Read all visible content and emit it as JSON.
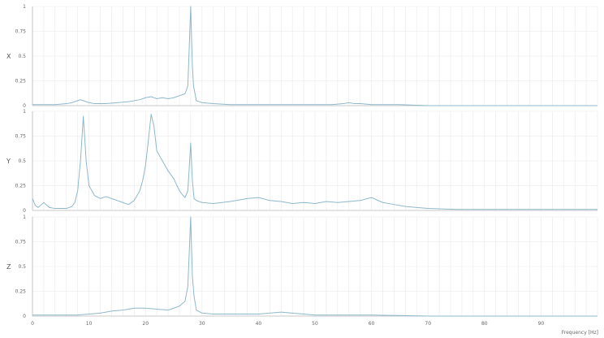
{
  "chart_data": {
    "type": "line",
    "xlabel": "Frequency [Hz]",
    "x_ticks": [
      0,
      10,
      20,
      30,
      40,
      50,
      60,
      70,
      80,
      90
    ],
    "xlim": [
      0,
      100
    ],
    "grid": true,
    "colors": {
      "line": "#8db8cc",
      "grid": "#e8e8e8",
      "axis": "#bbbbbb"
    },
    "panels": [
      {
        "ylabel": "X",
        "ylim": [
          0,
          1
        ],
        "y_ticks": [
          "0",
          "0.25",
          "0.5",
          "0.75",
          "1"
        ],
        "series": [
          {
            "x": [
              0,
              2,
              4,
              6,
              7,
              8,
              8.5,
              9,
              9.5,
              10,
              11,
              13,
              15,
              17,
              19,
              20,
              21,
              22,
              23,
              24,
              25,
              26,
              27,
              27.5,
              28,
              28.3,
              28.5,
              29,
              30,
              32,
              35,
              40,
              45,
              50,
              53,
              55,
              56,
              57,
              58,
              60,
              63,
              65,
              70,
              80,
              90,
              100
            ],
            "y": [
              0.01,
              0.01,
              0.01,
              0.02,
              0.03,
              0.05,
              0.06,
              0.05,
              0.04,
              0.03,
              0.02,
              0.02,
              0.03,
              0.04,
              0.06,
              0.08,
              0.09,
              0.07,
              0.08,
              0.07,
              0.08,
              0.1,
              0.12,
              0.2,
              1.0,
              0.4,
              0.2,
              0.05,
              0.03,
              0.02,
              0.01,
              0.01,
              0.01,
              0.01,
              0.01,
              0.02,
              0.03,
              0.02,
              0.02,
              0.01,
              0.01,
              0.01,
              0.0,
              0.0,
              0.0,
              0.0
            ]
          }
        ]
      },
      {
        "ylabel": "Y",
        "ylim": [
          0,
          1
        ],
        "y_ticks": [
          "0",
          "0.25",
          "0.5",
          "0.75",
          "1"
        ],
        "series": [
          {
            "x": [
              0,
              0.5,
              1,
              2,
              3,
              4,
              5,
              6,
              7,
              7.5,
              8,
              8.5,
              9,
              9.5,
              10,
              11,
              12,
              13,
              14,
              15,
              16,
              17,
              18,
              19,
              19.5,
              20,
              20.5,
              21,
              21.5,
              22,
              23,
              24,
              25,
              26,
              26.5,
              27,
              27.5,
              28,
              28.3,
              28.6,
              29,
              30,
              32,
              35,
              38,
              40,
              42,
              44,
              46,
              48,
              50,
              52,
              54,
              56,
              58,
              60,
              62,
              64,
              66,
              68,
              70,
              75,
              80,
              90,
              100
            ],
            "y": [
              0.12,
              0.05,
              0.03,
              0.08,
              0.03,
              0.02,
              0.02,
              0.02,
              0.04,
              0.08,
              0.2,
              0.5,
              0.95,
              0.5,
              0.25,
              0.15,
              0.12,
              0.14,
              0.12,
              0.1,
              0.08,
              0.06,
              0.1,
              0.2,
              0.3,
              0.45,
              0.7,
              0.97,
              0.85,
              0.6,
              0.5,
              0.4,
              0.32,
              0.2,
              0.16,
              0.13,
              0.2,
              0.68,
              0.3,
              0.12,
              0.1,
              0.08,
              0.07,
              0.09,
              0.12,
              0.13,
              0.1,
              0.09,
              0.07,
              0.08,
              0.07,
              0.09,
              0.08,
              0.09,
              0.1,
              0.13,
              0.08,
              0.06,
              0.04,
              0.03,
              0.02,
              0.01,
              0.01,
              0.01,
              0.01
            ]
          }
        ]
      },
      {
        "ylabel": "Z",
        "ylim": [
          0,
          1
        ],
        "y_ticks": [
          "0",
          "0.25",
          "0.5",
          "0.75",
          "1"
        ],
        "series": [
          {
            "x": [
              0,
              3,
              5,
              8,
              10,
              12,
              14,
              16,
              18,
              20,
              22,
              24,
              25,
              26,
              27,
              27.5,
              28,
              28.3,
              28.6,
              29,
              30,
              32,
              35,
              38,
              40,
              42,
              44,
              46,
              48,
              50,
              55,
              60,
              70,
              80,
              90,
              100
            ],
            "y": [
              0.01,
              0.01,
              0.01,
              0.01,
              0.02,
              0.03,
              0.05,
              0.06,
              0.08,
              0.08,
              0.07,
              0.06,
              0.08,
              0.1,
              0.15,
              0.3,
              1.0,
              0.4,
              0.2,
              0.06,
              0.03,
              0.02,
              0.02,
              0.02,
              0.02,
              0.03,
              0.04,
              0.03,
              0.02,
              0.01,
              0.01,
              0.01,
              0.0,
              0.0,
              0.0,
              0.0
            ]
          }
        ]
      }
    ]
  }
}
